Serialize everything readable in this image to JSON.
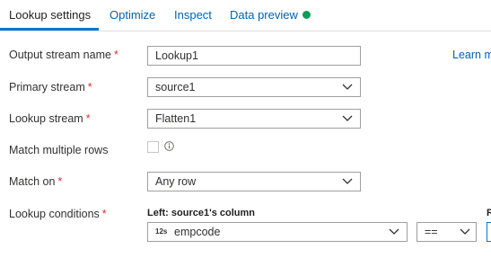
{
  "tabs": [
    {
      "label": "Lookup settings",
      "active": true
    },
    {
      "label": "Optimize",
      "active": false
    },
    {
      "label": "Inspect",
      "active": false
    },
    {
      "label": "Data preview",
      "active": false
    }
  ],
  "status_color": "#0f9d58",
  "learn_more": "Learn m",
  "form": {
    "output_stream_name": {
      "label": "Output stream name",
      "value": "Lookup1"
    },
    "primary_stream": {
      "label": "Primary stream",
      "value": "source1"
    },
    "lookup_stream": {
      "label": "Lookup stream",
      "value": "Flatten1"
    },
    "match_multiple_rows": {
      "label": "Match multiple rows",
      "checked": false
    },
    "match_on": {
      "label": "Match on",
      "value": "Any row"
    },
    "lookup_conditions": {
      "label": "Lookup conditions"
    }
  },
  "required_mark": "*",
  "conditions": {
    "left_header": "Left: source1's column",
    "right_header": "R",
    "left_type_badge": "12s",
    "left_column": "empcode",
    "operator": "=="
  },
  "icons": {
    "chevron": "chevron-down-icon",
    "info": "info-icon"
  }
}
